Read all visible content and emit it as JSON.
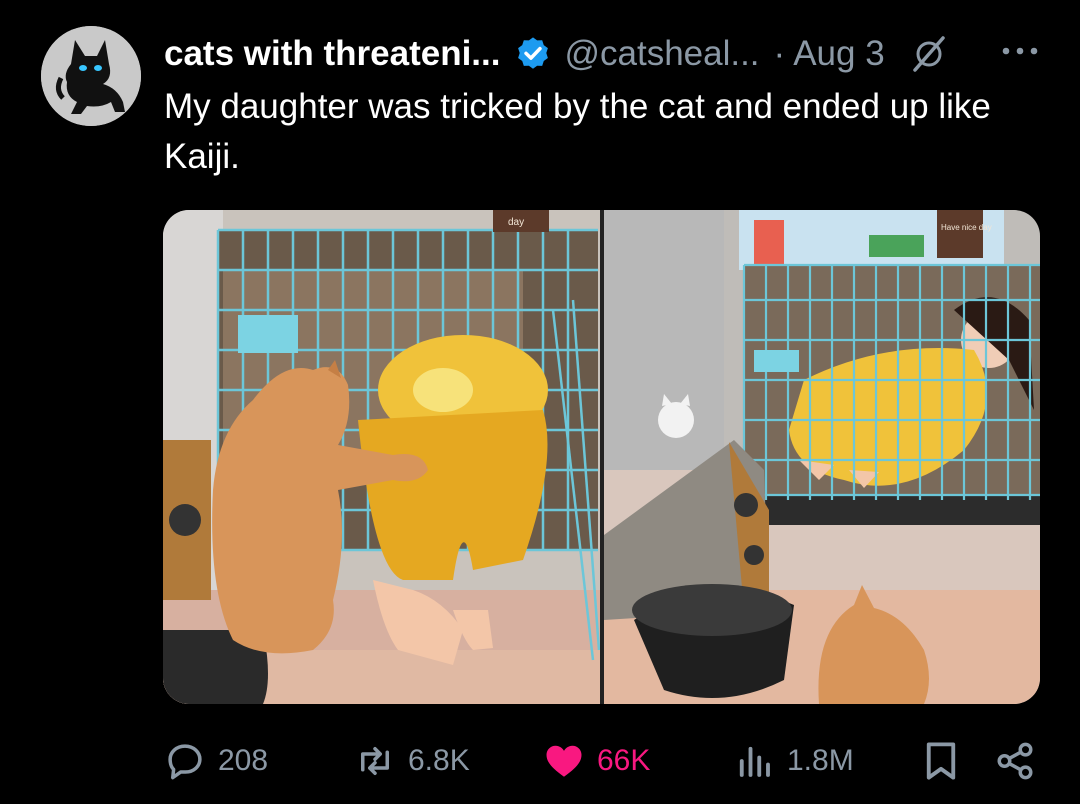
{
  "post": {
    "display_name": "cats with threateni...",
    "handle": "@catsheal...",
    "separator": "·",
    "date": "Aug 3",
    "text": "My daughter was tricked by the cat and ended up like Kaiji."
  },
  "media": {
    "left_image": "orange cat pushing child in yellow pajamas into a blue wire cage",
    "right_image": "child sitting locked inside the blue wire cage, orange cat outside",
    "cage_sign_left": "day",
    "cage_sign_right": "Have nice day"
  },
  "actions": {
    "replies": "208",
    "reposts": "6.8K",
    "likes": "66K",
    "views": "1.8M"
  },
  "colors": {
    "background": "#000000",
    "verified": "#1d9bf0",
    "like": "#f91880",
    "muted": "#8b98a5",
    "cage": "#6cc6d8"
  }
}
